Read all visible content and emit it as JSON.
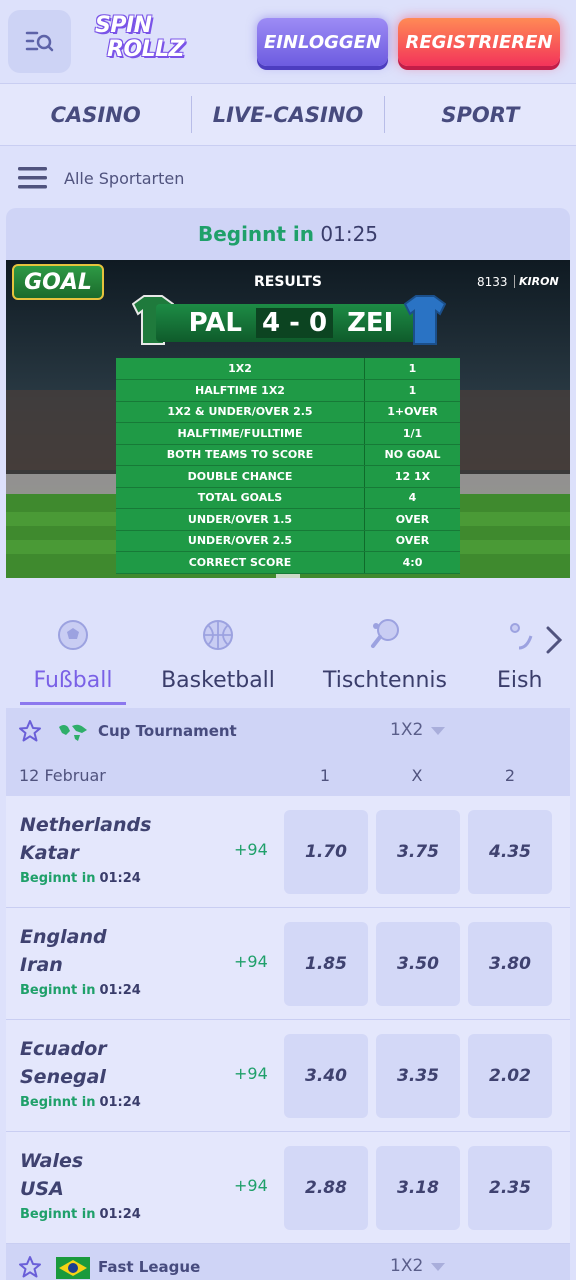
{
  "header": {
    "logo_line1": "SPIN",
    "logo_line2": "ROLLZ",
    "login_label": "EINLOGGEN",
    "register_label": "REGISTRIEREN"
  },
  "nav": {
    "items": [
      {
        "label": "CASINO"
      },
      {
        "label": "LIVE-CASINO"
      },
      {
        "label": "SPORT"
      }
    ]
  },
  "sports_menu": {
    "label": "Alle Sportarten"
  },
  "live": {
    "countdown_label": "Beginnt in",
    "countdown_time": "01:25",
    "video": {
      "logo": "GOAL",
      "title": "RESULTS",
      "match_id": "8133",
      "provider": "KIRON",
      "home": "PAL",
      "score": "4 - 0",
      "away": "ZEI",
      "markets": [
        {
          "name": "1X2",
          "result": "1"
        },
        {
          "name": "HALFTIME 1X2",
          "result": "1"
        },
        {
          "name": "1X2 & UNDER/OVER 2.5",
          "result": "1+OVER"
        },
        {
          "name": "HALFTIME/FULLTIME",
          "result": "1/1"
        },
        {
          "name": "BOTH TEAMS TO SCORE",
          "result": "NO GOAL"
        },
        {
          "name": "DOUBLE CHANCE",
          "result": "12   1X"
        },
        {
          "name": "TOTAL GOALS",
          "result": "4"
        },
        {
          "name": "UNDER/OVER 1.5",
          "result": "OVER"
        },
        {
          "name": "UNDER/OVER 2.5",
          "result": "OVER"
        },
        {
          "name": "CORRECT SCORE",
          "result": "4:0"
        }
      ]
    }
  },
  "sport_tabs": [
    {
      "label": "Fußball",
      "icon": "soccer-ball-icon",
      "active": true
    },
    {
      "label": "Basketball",
      "icon": "basketball-icon",
      "active": false
    },
    {
      "label": "Tischtennis",
      "icon": "table-tennis-icon",
      "active": false
    },
    {
      "label": "Eish",
      "icon": "ice-hockey-icon",
      "active": false
    }
  ],
  "tournament": {
    "name": "Cup Tournament",
    "market": "1X2",
    "date": "12 Februar",
    "columns": [
      "1",
      "X",
      "2"
    ]
  },
  "matches": [
    {
      "home": "Netherlands",
      "away": "Katar",
      "status": "Beginnt in",
      "time": "01:24",
      "more": "+94",
      "odds": [
        "1.70",
        "3.75",
        "4.35"
      ]
    },
    {
      "home": "England",
      "away": "Iran",
      "status": "Beginnt in",
      "time": "01:24",
      "more": "+94",
      "odds": [
        "1.85",
        "3.50",
        "3.80"
      ]
    },
    {
      "home": "Ecuador",
      "away": "Senegal",
      "status": "Beginnt in",
      "time": "01:24",
      "more": "+94",
      "odds": [
        "3.40",
        "3.35",
        "2.02"
      ]
    },
    {
      "home": "Wales",
      "away": "USA",
      "status": "Beginnt in",
      "time": "01:24",
      "more": "+94",
      "odds": [
        "2.88",
        "3.18",
        "2.35"
      ]
    }
  ],
  "tournament2": {
    "name": "Fast League",
    "market": "1X2"
  },
  "colors": {
    "accent": "#7a61e6",
    "green": "#1fa06a",
    "register": "#f3345a",
    "login": "#6d5ce0"
  }
}
